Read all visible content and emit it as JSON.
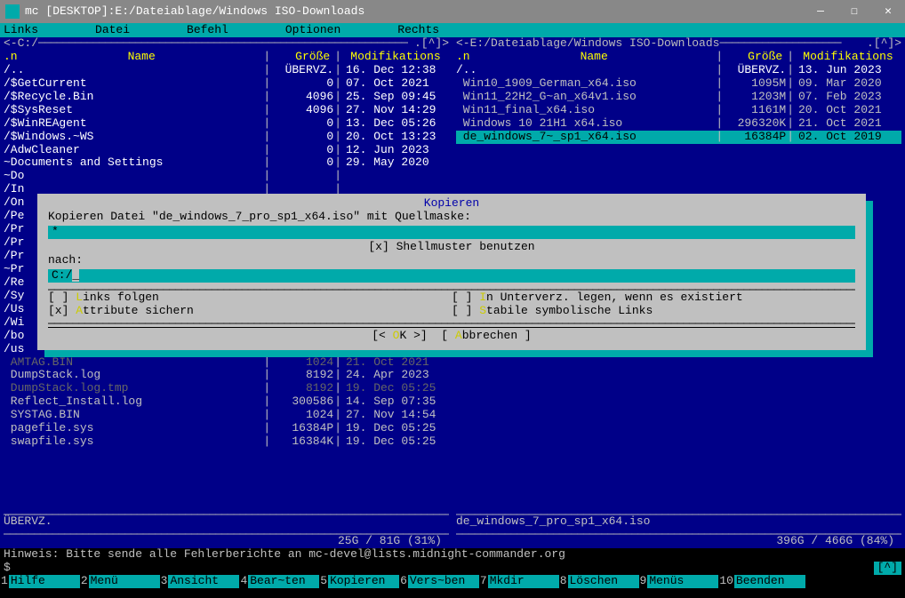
{
  "window": {
    "title": "mc [DESKTOP]:E:/Dateiablage/Windows ISO-Downloads"
  },
  "menu": {
    "i0": "Links",
    "i1": "Datei",
    "i2": "Befehl",
    "i3": "Optionen",
    "i4": "Rechts"
  },
  "left": {
    "path": "C:/",
    "prefix": "<-",
    "suffix": ".[^]>",
    "hdr_n": ".n",
    "hdr_name": "Name",
    "hdr_size": "Größe",
    "hdr_mod": "Modifikations",
    "rows": [
      {
        "n": "/..",
        "s": "ÜBERVZ.",
        "m": "16. Dec 12:38",
        "dir": true
      },
      {
        "n": "/$GetCurrent",
        "s": "0",
        "m": "07. Oct 2021",
        "dir": true
      },
      {
        "n": "/$Recycle.Bin",
        "s": "4096",
        "m": "25. Sep 09:45",
        "dir": true
      },
      {
        "n": "/$SysReset",
        "s": "4096",
        "m": "27. Nov 14:29",
        "dir": true
      },
      {
        "n": "/$WinREAgent",
        "s": "0",
        "m": "13. Dec 05:26",
        "dir": true
      },
      {
        "n": "/$Windows.~WS",
        "s": "0",
        "m": "20. Oct 13:23",
        "dir": true
      },
      {
        "n": "/AdwCleaner",
        "s": "0",
        "m": "12. Jun 2023",
        "dir": true
      },
      {
        "n": "~Documents and Settings",
        "s": "0",
        "m": "29. May 2020",
        "dir": true
      },
      {
        "n": "~Do",
        "s": "",
        "m": "",
        "dir": true
      },
      {
        "n": "/In",
        "s": "",
        "m": "",
        "dir": true
      },
      {
        "n": "/On",
        "s": "",
        "m": "",
        "dir": true
      },
      {
        "n": "/Pe",
        "s": "",
        "m": "",
        "dir": true
      },
      {
        "n": "/Pr",
        "s": "",
        "m": "",
        "dir": true
      },
      {
        "n": "/Pr",
        "s": "",
        "m": "",
        "dir": true
      },
      {
        "n": "/Pr",
        "s": "",
        "m": "",
        "dir": true
      },
      {
        "n": "~Pr",
        "s": "",
        "m": "",
        "dir": true
      },
      {
        "n": "/Re",
        "s": "",
        "m": "",
        "dir": true
      },
      {
        "n": "/Sy",
        "s": "",
        "m": "",
        "dir": true
      },
      {
        "n": "/Us",
        "s": "",
        "m": "",
        "dir": true
      },
      {
        "n": "/Wi",
        "s": "",
        "m": "",
        "dir": true
      },
      {
        "n": "/bo",
        "s": "",
        "m": "",
        "dir": true
      },
      {
        "n": "/us",
        "s": "",
        "m": "",
        "dir": true
      },
      {
        "n": " AMTAG.BIN",
        "s": "1024",
        "m": "21. Oct 2021",
        "gray": true
      },
      {
        "n": " DumpStack.log",
        "s": "8192",
        "m": "24. Apr 2023"
      },
      {
        "n": " DumpStack.log.tmp",
        "s": "8192",
        "m": "19. Dec 05:25",
        "gray": true
      },
      {
        "n": " Reflect_Install.log",
        "s": "300586",
        "m": "14. Sep 07:35"
      },
      {
        "n": " SYSTAG.BIN",
        "s": "1024",
        "m": "27. Nov 14:54"
      },
      {
        "n": " pagefile.sys",
        "s": "16384P",
        "m": "19. Dec 05:25"
      },
      {
        "n": " swapfile.sys",
        "s": "16384K",
        "m": "19. Dec 05:25"
      }
    ],
    "footer1": "ÜBERVZ.",
    "footer2": "25G / 81G (31%)"
  },
  "right": {
    "path": "E:/Dateiablage/Windows ISO-Downloads",
    "prefix": "<-",
    "suffix": ".[^]>",
    "hdr_n": ".n",
    "hdr_name": "Name",
    "hdr_size": "Größe",
    "hdr_mod": "Modifikations",
    "rows": [
      {
        "n": "/..",
        "s": "ÜBERVZ.",
        "m": "13. Jun 2023",
        "dir": true
      },
      {
        "n": " Win10_1909_German_x64.iso",
        "s": "1095M",
        "m": "09. Mar 2020"
      },
      {
        "n": " Win11_22H2_G~an_x64v1.iso",
        "s": "1203M",
        "m": "07. Feb 2023"
      },
      {
        "n": " Win11_final_x64.iso",
        "s": "1161M",
        "m": "20. Oct 2021"
      },
      {
        "n": " Windows 10 21H1 x64.iso",
        "s": "296320K",
        "m": "21. Oct 2021"
      },
      {
        "n": " de_windows_7~_sp1_x64.iso",
        "s": "16384P",
        "m": "02. Oct 2019",
        "sel": true
      }
    ],
    "footer1": "de_windows_7_pro_sp1_x64.iso",
    "footer2": "396G / 466G (84%)"
  },
  "dialog": {
    "title": "Kopieren",
    "label1": "Kopieren Datei \"de_windows_7_pro_sp1_x64.iso\" mit Quellmaske:",
    "input1": "*",
    "shellmuster": "[x] Shellmuster benutzen",
    "label2": "nach:",
    "input2": "C:/",
    "chk1": "[ ] Links folgen",
    "chk2": "[x] Attribute sichern",
    "chk3": "[ ] In Unterverz. legen, wenn es existiert",
    "chk4": "[ ] Stabile symbolische Links",
    "ok": "[< OK >]",
    "cancel": "[ Abbrechen ]"
  },
  "hint": "Hinweis: Bitte sende alle Fehlerberichte an mc-devel@lists.midnight-commander.org",
  "prompt": "$",
  "promptright": "[^]",
  "fkeys": [
    {
      "n": "1",
      "l": "Hilfe"
    },
    {
      "n": "2",
      "l": "Menü"
    },
    {
      "n": "3",
      "l": "Ansicht"
    },
    {
      "n": "4",
      "l": "Bear~ten"
    },
    {
      "n": "5",
      "l": "Kopieren"
    },
    {
      "n": "6",
      "l": "Vers~ben"
    },
    {
      "n": "7",
      "l": "Mkdir"
    },
    {
      "n": "8",
      "l": "Löschen"
    },
    {
      "n": "9",
      "l": "Menüs"
    },
    {
      "n": "10",
      "l": "Beenden"
    }
  ]
}
